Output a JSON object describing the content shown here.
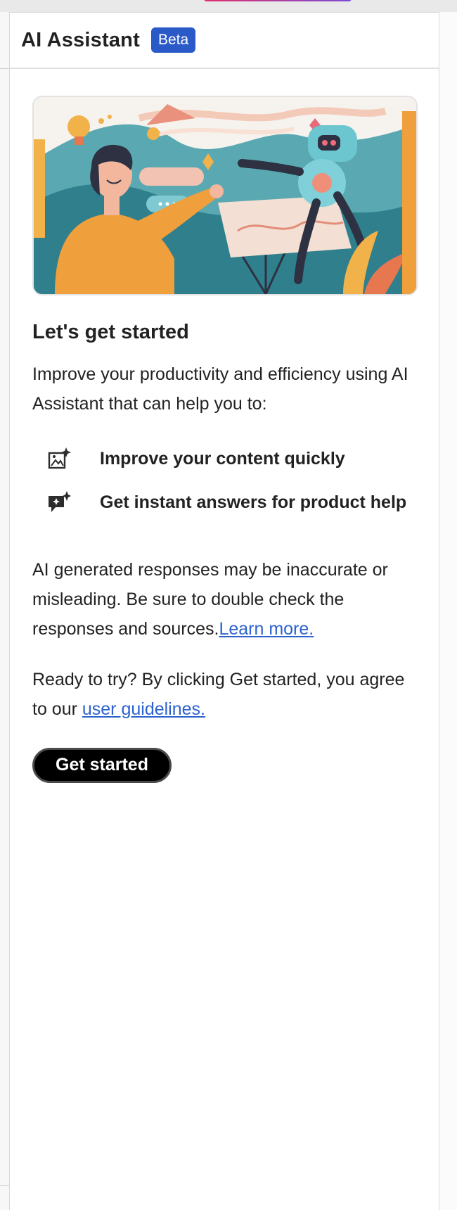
{
  "header": {
    "title": "AI Assistant",
    "badge": "Beta"
  },
  "hero": {
    "icon": "illustration-person-and-robot"
  },
  "main": {
    "heading": "Let's get started",
    "intro": "Improve your productivity and efficiency using AI Assistant that can help you to:",
    "features": [
      {
        "icon": "image-sparkle-icon",
        "label": "Improve your content quickly"
      },
      {
        "icon": "chat-sparkle-icon",
        "label": "Get instant answers for product help"
      }
    ],
    "disclaimer_text": "AI generated responses may be inaccurate or misleading. Be sure to double check the responses and sources.",
    "disclaimer_link": "Learn more.",
    "agree_text": "Ready to try? By clicking Get started, you agree to our ",
    "agree_link": "user guidelines.",
    "cta_label": "Get started"
  },
  "colors": {
    "badge_bg": "#2a59c8",
    "link": "#2b62cf",
    "cta_bg": "#000000"
  }
}
